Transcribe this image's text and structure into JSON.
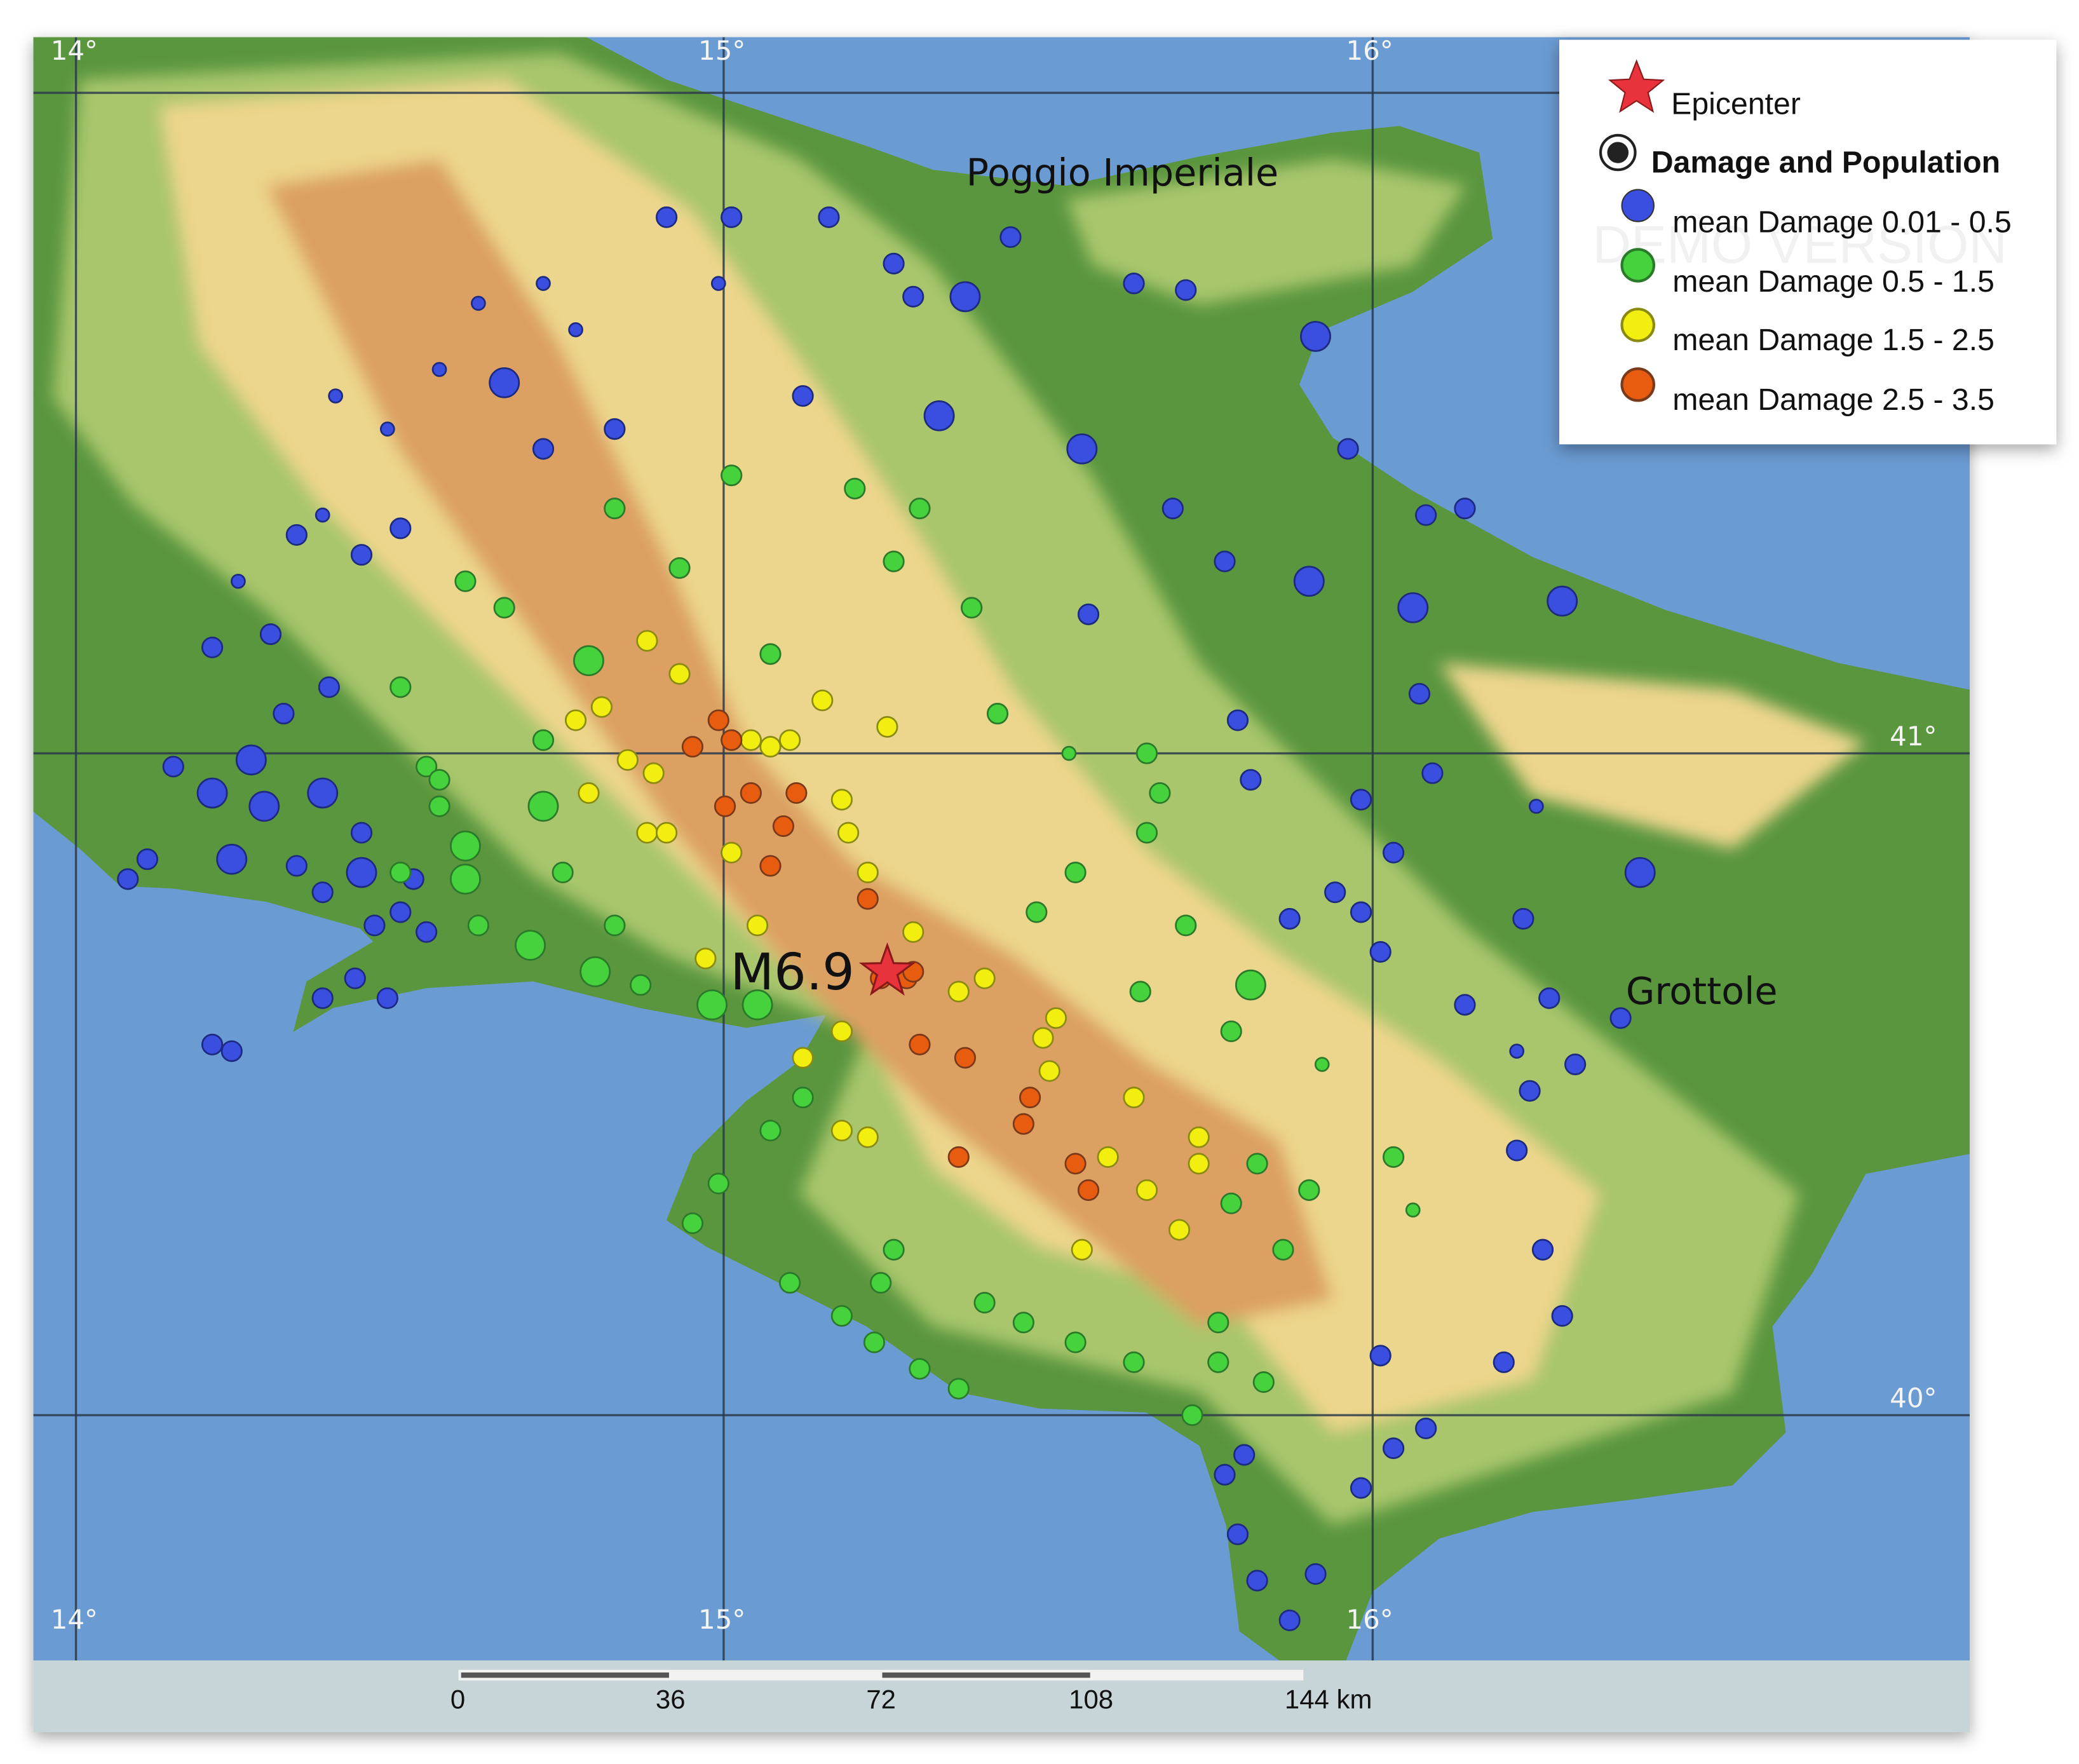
{
  "map": {
    "lon_labels": [
      "14°",
      "15°",
      "16°"
    ],
    "lat_labels": [
      "41°",
      "40°"
    ],
    "places": [
      {
        "name": "Poggio Imperiale",
        "lon": 15.37,
        "lat": 41.87
      },
      {
        "name": "Grottole",
        "lon": 16.38,
        "lat": 40.62
      }
    ],
    "epicenter": {
      "label": "M6.9",
      "lon": 15.25,
      "lat": 40.67,
      "color": "#e8323c"
    },
    "colors": {
      "sea": "#6a9bd3",
      "lowland": "#5a963e",
      "hill": "#a9c66c",
      "upland": "#ecd58c",
      "mountain": "#dca062"
    },
    "damage_colors": [
      "#3a4fe0",
      "#46d23c",
      "#f2ee10",
      "#e85c10"
    ],
    "points": [
      [
        14.21,
        40.94,
        0,
        3
      ],
      [
        14.15,
        40.98,
        0
      ],
      [
        14.24,
        40.84,
        0,
        3
      ],
      [
        14.11,
        40.84,
        0
      ],
      [
        14.08,
        40.81,
        0
      ],
      [
        14.38,
        40.94,
        0,
        3
      ],
      [
        14.44,
        40.88,
        0
      ],
      [
        14.34,
        40.83,
        0
      ],
      [
        14.38,
        40.79,
        0
      ],
      [
        14.5,
        40.76,
        0
      ],
      [
        14.54,
        40.73,
        0
      ],
      [
        14.46,
        40.74,
        0
      ],
      [
        14.21,
        41.16,
        0
      ],
      [
        14.34,
        41.33,
        0
      ],
      [
        14.38,
        41.36,
        0,
        1
      ],
      [
        14.44,
        41.3,
        0
      ],
      [
        14.5,
        41.34,
        0
      ],
      [
        14.48,
        41.49,
        0,
        1
      ],
      [
        14.56,
        41.58,
        0,
        1
      ],
      [
        14.66,
        41.56,
        0,
        3
      ],
      [
        14.72,
        41.46,
        0
      ],
      [
        14.83,
        41.49,
        0
      ],
      [
        14.62,
        41.68,
        0,
        1
      ],
      [
        14.72,
        41.71,
        0,
        1
      ],
      [
        14.91,
        41.81,
        0
      ],
      [
        15.01,
        41.81,
        0
      ],
      [
        15.16,
        41.81,
        0
      ],
      [
        15.26,
        41.74,
        0
      ],
      [
        15.29,
        41.69,
        0
      ],
      [
        15.37,
        41.69,
        0,
        3
      ],
      [
        15.44,
        41.78,
        0
      ],
      [
        15.63,
        41.71,
        0
      ],
      [
        15.71,
        41.7,
        0
      ],
      [
        15.91,
        41.63,
        0,
        3
      ],
      [
        15.33,
        41.51,
        0,
        3
      ],
      [
        15.55,
        41.46,
        0,
        3
      ],
      [
        15.69,
        41.37,
        0
      ],
      [
        15.77,
        41.29,
        0
      ],
      [
        15.9,
        41.26,
        0,
        3
      ],
      [
        16.06,
        41.22,
        0,
        3
      ],
      [
        16.29,
        41.23,
        0,
        3
      ],
      [
        16.14,
        41.37,
        0
      ],
      [
        15.96,
        41.46,
        0
      ],
      [
        16.08,
        41.36,
        0
      ],
      [
        15.56,
        41.21,
        0
      ],
      [
        15.79,
        41.05,
        0
      ],
      [
        16.07,
        41.09,
        0
      ],
      [
        15.81,
        40.96,
        0
      ],
      [
        15.98,
        40.93,
        0
      ],
      [
        16.09,
        40.97,
        0
      ],
      [
        16.03,
        40.85,
        0
      ],
      [
        16.25,
        40.92,
        0,
        1
      ],
      [
        16.41,
        40.82,
        0,
        3
      ],
      [
        16.23,
        40.75,
        0
      ],
      [
        15.94,
        40.79,
        0
      ],
      [
        15.87,
        40.75,
        0
      ],
      [
        15.98,
        40.76,
        0
      ],
      [
        16.01,
        40.7,
        0
      ],
      [
        16.14,
        40.62,
        0
      ],
      [
        16.27,
        40.63,
        0
      ],
      [
        16.38,
        40.6,
        0
      ],
      [
        16.31,
        40.53,
        0
      ],
      [
        16.22,
        40.55,
        0,
        1
      ],
      [
        16.24,
        40.49,
        0
      ],
      [
        16.22,
        40.4,
        0
      ],
      [
        16.26,
        40.25,
        0
      ],
      [
        16.29,
        40.15,
        0
      ],
      [
        16.2,
        40.08,
        0
      ],
      [
        16.01,
        40.09,
        0
      ],
      [
        16.08,
        39.98,
        0
      ],
      [
        16.03,
        39.95,
        0
      ],
      [
        15.98,
        39.89,
        0
      ],
      [
        15.8,
        39.94,
        0
      ],
      [
        15.77,
        39.91,
        0
      ],
      [
        15.82,
        39.75,
        0
      ],
      [
        15.87,
        39.69,
        0
      ],
      [
        15.91,
        39.76,
        0
      ],
      [
        15.79,
        39.82,
        0
      ],
      [
        14.21,
        40.56,
        0
      ],
      [
        14.24,
        40.55,
        0
      ],
      [
        14.38,
        40.63,
        0
      ],
      [
        14.43,
        40.66,
        0
      ],
      [
        14.48,
        40.63,
        0
      ],
      [
        14.29,
        40.92,
        0,
        3
      ],
      [
        14.27,
        40.99,
        0,
        3
      ],
      [
        14.32,
        41.06,
        0
      ],
      [
        14.39,
        41.1,
        0
      ],
      [
        14.3,
        41.18,
        0
      ],
      [
        14.25,
        41.26,
        0,
        1
      ],
      [
        14.44,
        40.82,
        0,
        3
      ],
      [
        14.52,
        40.81,
        0
      ],
      [
        14.4,
        41.54,
        0,
        1
      ],
      [
        14.77,
        41.64,
        0,
        1
      ],
      [
        14.99,
        41.71,
        0,
        1
      ],
      [
        15.12,
        41.54,
        0
      ],
      [
        14.79,
        41.14,
        1,
        3
      ],
      [
        14.66,
        41.22,
        1
      ],
      [
        14.5,
        41.1,
        1
      ],
      [
        14.54,
        40.98,
        1
      ],
      [
        14.56,
        40.92,
        1
      ],
      [
        14.5,
        40.82,
        1
      ],
      [
        14.6,
        40.81,
        1,
        3
      ],
      [
        14.7,
        40.71,
        1,
        3
      ],
      [
        14.8,
        40.67,
        1,
        3
      ],
      [
        14.98,
        40.62,
        1,
        3
      ],
      [
        15.05,
        40.62,
        1,
        3
      ],
      [
        14.87,
        40.65,
        1
      ],
      [
        15.01,
        41.42,
        1
      ],
      [
        15.2,
        41.4,
        1
      ],
      [
        15.3,
        41.37,
        1
      ],
      [
        15.26,
        41.29,
        1
      ],
      [
        15.38,
        41.22,
        1
      ],
      [
        15.42,
        41.06,
        1
      ],
      [
        15.53,
        41.0,
        1,
        1
      ],
      [
        15.65,
        41.0,
        1
      ],
      [
        15.67,
        40.94,
        1
      ],
      [
        15.65,
        40.88,
        1
      ],
      [
        15.54,
        40.82,
        1
      ],
      [
        15.48,
        40.76,
        1
      ],
      [
        15.64,
        40.64,
        1
      ],
      [
        15.81,
        40.65,
        1,
        3
      ],
      [
        15.78,
        40.58,
        1
      ],
      [
        15.71,
        40.74,
        1
      ],
      [
        15.92,
        40.53,
        1,
        1
      ],
      [
        15.82,
        40.38,
        1
      ],
      [
        15.9,
        40.34,
        1
      ],
      [
        16.03,
        40.39,
        1
      ],
      [
        16.06,
        40.31,
        1,
        1
      ],
      [
        15.78,
        40.32,
        1
      ],
      [
        15.86,
        40.25,
        1
      ],
      [
        15.76,
        40.14,
        1
      ],
      [
        15.76,
        40.08,
        1
      ],
      [
        15.83,
        40.05,
        1
      ],
      [
        15.72,
        40.0,
        1
      ],
      [
        15.63,
        40.08,
        1
      ],
      [
        15.54,
        40.11,
        1
      ],
      [
        15.46,
        40.14,
        1
      ],
      [
        15.36,
        40.04,
        1
      ],
      [
        15.3,
        40.07,
        1
      ],
      [
        15.23,
        40.11,
        1
      ],
      [
        15.18,
        40.15,
        1
      ],
      [
        15.1,
        40.2,
        1
      ],
      [
        14.95,
        40.29,
        1
      ],
      [
        14.99,
        40.35,
        1
      ],
      [
        15.07,
        40.43,
        1
      ],
      [
        15.12,
        40.48,
        1
      ],
      [
        15.26,
        40.25,
        1
      ],
      [
        15.24,
        40.2,
        1
      ],
      [
        15.4,
        40.17,
        1
      ],
      [
        14.6,
        40.86,
        1,
        3
      ],
      [
        14.56,
        40.96,
        1
      ],
      [
        14.72,
        40.92,
        1,
        3
      ],
      [
        14.62,
        40.74,
        1
      ],
      [
        14.75,
        40.82,
        1
      ],
      [
        14.83,
        40.74,
        1
      ],
      [
        14.72,
        41.02,
        1
      ],
      [
        14.6,
        41.26,
        1
      ],
      [
        14.83,
        41.37,
        1
      ],
      [
        14.93,
        41.28,
        1
      ],
      [
        15.07,
        41.15,
        1
      ],
      [
        14.77,
        41.05,
        2
      ],
      [
        14.81,
        41.07,
        2
      ],
      [
        14.85,
        40.99,
        2
      ],
      [
        14.89,
        40.97,
        2
      ],
      [
        14.79,
        40.94,
        2
      ],
      [
        14.88,
        40.88,
        2
      ],
      [
        14.91,
        40.88,
        2
      ],
      [
        14.93,
        41.12,
        2
      ],
      [
        14.88,
        41.17,
        2
      ],
      [
        15.04,
        41.02,
        2
      ],
      [
        15.07,
        41.01,
        2
      ],
      [
        15.1,
        41.02,
        2
      ],
      [
        15.15,
        41.08,
        2
      ],
      [
        15.25,
        41.04,
        2
      ],
      [
        15.18,
        40.93,
        2
      ],
      [
        15.19,
        40.88,
        2
      ],
      [
        15.22,
        40.82,
        2
      ],
      [
        15.29,
        40.73,
        2
      ],
      [
        15.36,
        40.64,
        2
      ],
      [
        15.4,
        40.66,
        2
      ],
      [
        15.51,
        40.6,
        2
      ],
      [
        15.49,
        40.57,
        2
      ],
      [
        15.5,
        40.52,
        2
      ],
      [
        15.63,
        40.48,
        2
      ],
      [
        15.73,
        40.42,
        2
      ],
      [
        15.73,
        40.38,
        2
      ],
      [
        15.65,
        40.34,
        2
      ],
      [
        15.7,
        40.28,
        2
      ],
      [
        15.55,
        40.25,
        2
      ],
      [
        15.59,
        40.39,
        2
      ],
      [
        15.12,
        40.54,
        2
      ],
      [
        15.18,
        40.43,
        2
      ],
      [
        15.22,
        40.42,
        2
      ],
      [
        15.18,
        40.58,
        2
      ],
      [
        15.05,
        40.74,
        2
      ],
      [
        15.01,
        40.85,
        2
      ],
      [
        14.97,
        40.69,
        2
      ],
      [
        14.99,
        41.05,
        3
      ],
      [
        15.01,
        41.02,
        3
      ],
      [
        14.95,
        41.01,
        3
      ],
      [
        15.0,
        40.92,
        3
      ],
      [
        15.04,
        40.94,
        3
      ],
      [
        15.11,
        40.94,
        3
      ],
      [
        15.09,
        40.89,
        3
      ],
      [
        15.07,
        40.83,
        3
      ],
      [
        15.22,
        40.78,
        3
      ],
      [
        15.3,
        40.56,
        3
      ],
      [
        15.24,
        40.66,
        3
      ],
      [
        15.28,
        40.66,
        3
      ],
      [
        15.47,
        40.48,
        3
      ],
      [
        15.46,
        40.44,
        3
      ],
      [
        15.37,
        40.54,
        3
      ],
      [
        15.54,
        40.38,
        3
      ],
      [
        15.56,
        40.34,
        3
      ],
      [
        15.36,
        40.39,
        3
      ],
      [
        15.29,
        40.67,
        3
      ]
    ]
  },
  "legend": {
    "epicenter_label": "Epicenter",
    "layer_label": "Damage and Population",
    "items": [
      {
        "label": "mean Damage 0.01 - 0.5",
        "color": "#3a4fe0"
      },
      {
        "label": "mean Damage 0.5 - 1.5",
        "color": "#46d23c"
      },
      {
        "label": "mean Damage 1.5 - 2.5",
        "color": "#f2ee10"
      },
      {
        "label": "mean Damage 2.5 - 3.5",
        "color": "#e85c10"
      }
    ],
    "watermark": "DEMO VERSION"
  },
  "scale_bar": {
    "ticks": [
      "0",
      "36",
      "72",
      "108",
      "144 km"
    ]
  }
}
